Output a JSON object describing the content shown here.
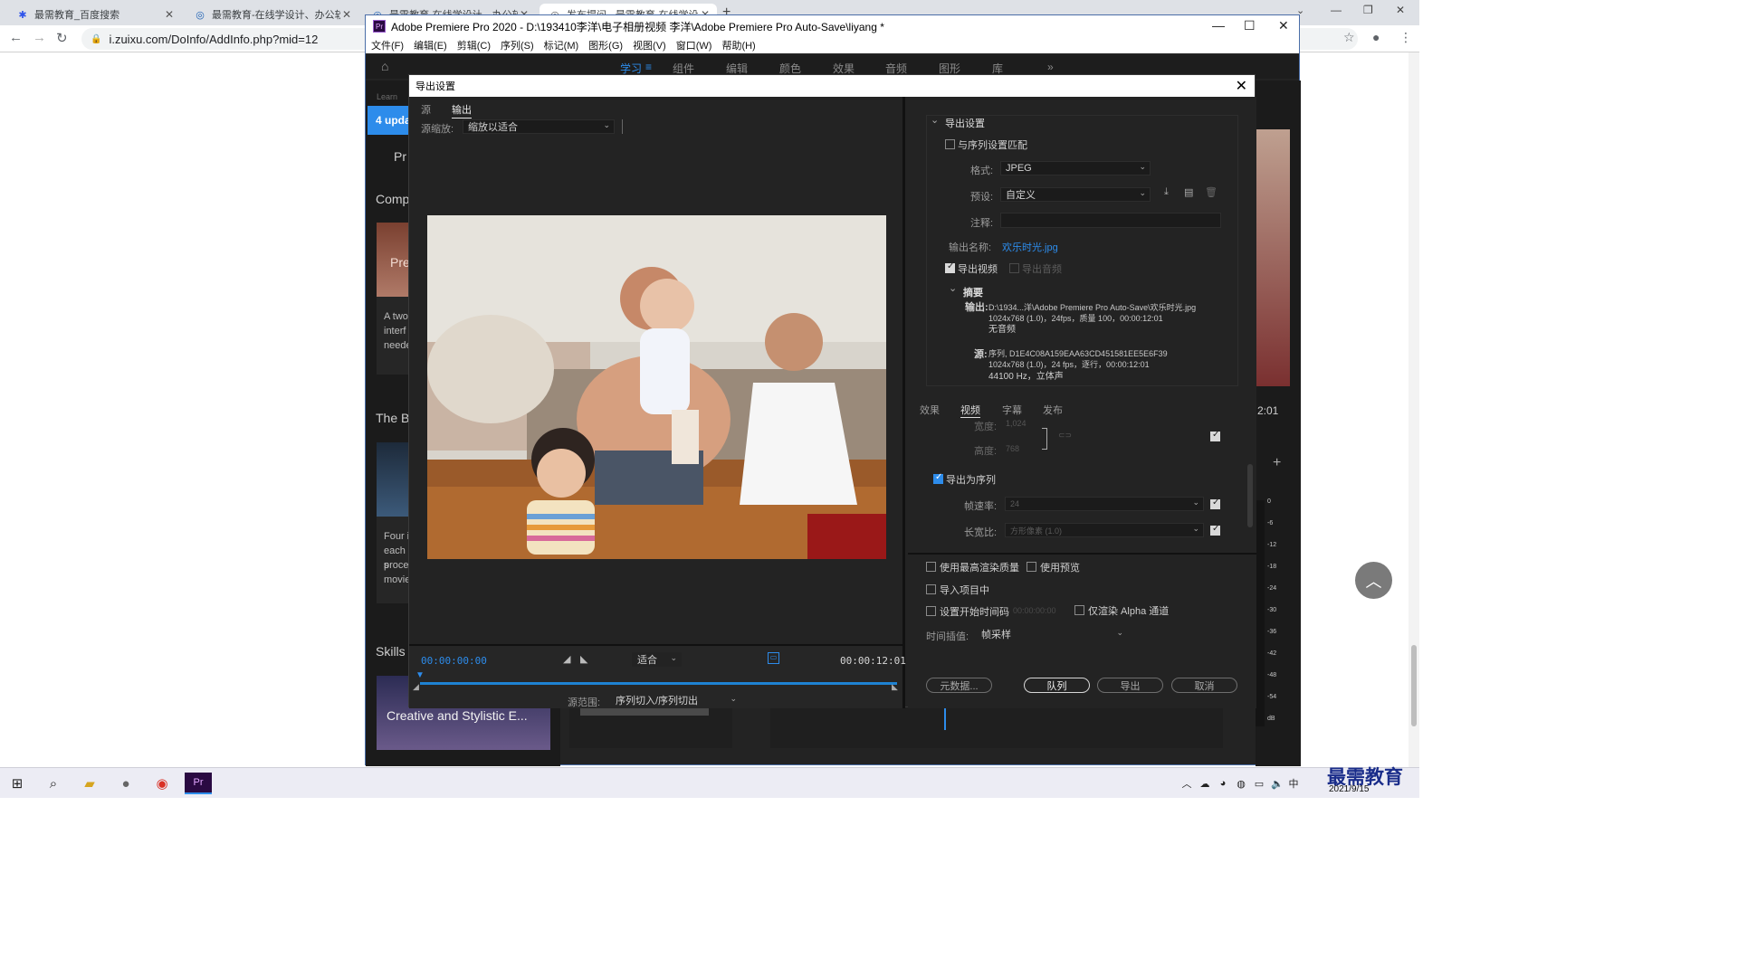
{
  "browser": {
    "tabs": [
      {
        "title": "最需教育_百度搜索",
        "icon": "baidu-paw-icon"
      },
      {
        "title": "最需教育-在线学设计、办公软件",
        "icon": "zuixu-site-icon"
      },
      {
        "title": "最需教育-在线学设计、办公软件",
        "icon": "zuixu-site-icon"
      },
      {
        "title": "发布提问 - 最需教育-在线学设计",
        "icon": "zuixu-site-icon"
      }
    ],
    "address": "i.zuixu.com/DoInfo/AddInfo.php?mid=12"
  },
  "premiere": {
    "window_title": "Adobe Premiere Pro 2020 - D:\\193410李洋\\电子相册视频 李洋\\Adobe Premiere Pro Auto-Save\\liyang *",
    "menu": [
      "文件(F)",
      "编辑(E)",
      "剪辑(C)",
      "序列(S)",
      "标记(M)",
      "图形(G)",
      "视图(V)",
      "窗口(W)",
      "帮助(H)"
    ],
    "workspaces": [
      "学习",
      "组件",
      "编辑",
      "颜色",
      "效果",
      "音频",
      "图形",
      "库"
    ],
    "active_workspace": "学习",
    "learn_panel": {
      "header": "Learn",
      "update_badge": "4 upda",
      "pr_label": "Pr",
      "sections": [
        "Comp",
        "The B",
        "Skills"
      ],
      "card1_title": "Pre",
      "card1_desc": [
        "A two",
        "interf",
        "neede"
      ],
      "card2_desc": [
        "Four i",
        "each s",
        "proce",
        "movie"
      ],
      "card3_title": "Creative and Stylistic E..."
    },
    "right_strip": {
      "timecode": "2:01",
      "meter_ticks": [
        "0",
        "-6",
        "-12",
        "-18",
        "-24",
        "-30",
        "-36",
        "-42",
        "-48",
        "-54",
        "dB"
      ]
    }
  },
  "export_dialog": {
    "title": "导出设置",
    "left": {
      "tabs": [
        "源",
        "输出"
      ],
      "active_tab": "输出",
      "source_scale_label": "源缩放:",
      "source_scale_value": "缩放以适合",
      "timecode_start": "00:00:00:00",
      "timecode_end": "00:00:12:01",
      "fit_value": "适合",
      "source_range_label": "源范围:",
      "source_range_value": "序列切入/序列切出"
    },
    "right": {
      "section_title": "导出设置",
      "match_sequence": "与序列设置匹配",
      "format_label": "格式:",
      "format_value": "JPEG",
      "preset_label": "预设:",
      "preset_value": "自定义",
      "comment_label": "注释:",
      "output_name_label": "输出名称:",
      "output_name_value": "欢乐时光.jpg",
      "export_video": "导出视频",
      "export_audio": "导出音频",
      "summary_title": "摘要",
      "summary_output_label": "输出:",
      "summary_output_lines": [
        "D:\\1934...洋\\Adobe Premiere Pro Auto-Save\\欢乐时光.jpg",
        "1024x768 (1.0)，24fps，质量 100，00:00:12:01",
        "无音频"
      ],
      "summary_source_label": "源:",
      "summary_source_lines": [
        "序列, D1E4C08A159EAA63CD451581EE5E6F39",
        "1024x768 (1.0)，24 fps，逐行，00:00:12:01",
        "44100 Hz，立体声"
      ],
      "subtabs": [
        "效果",
        "视频",
        "字幕",
        "发布"
      ],
      "active_subtab": "视频",
      "width_label": "宽度:",
      "width_value": "1,024",
      "height_label": "高度:",
      "height_value": "768",
      "export_as_sequence": "导出为序列",
      "framerate_label": "帧速率:",
      "framerate_value": "24",
      "aspect_label": "长宽比:",
      "aspect_value": "方形像素 (1.0)",
      "max_render_quality": "使用最高渲染质量",
      "use_previews": "使用预览",
      "import_into_project": "导入项目中",
      "set_start_timecode": "设置开始时间码",
      "start_timecode_value": "00:00:00:00",
      "render_alpha_only": "仅渲染 Alpha 通道",
      "time_interp_label": "时间插值:",
      "time_interp_value": "帧采样",
      "metadata_btn": "元数据...",
      "queue_btn": "队列",
      "export_btn": "导出",
      "cancel_btn": "取消"
    }
  },
  "taskbar": {
    "date": "2021/9/15",
    "watermark": "最需教育",
    "ime": "中"
  },
  "colors": {
    "accent_blue": "#2d8ceb",
    "panel_bg": "#232323",
    "dialog_title_bg": "#ffffff"
  }
}
